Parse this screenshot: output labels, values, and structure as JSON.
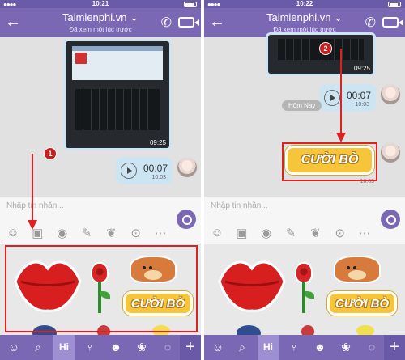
{
  "left": {
    "status_time": "10:21",
    "header_title": "Taimienphi.vn",
    "header_chevron": "⌄",
    "header_subtitle": "Đã xem một lúc trước",
    "photo_duration": "09:25",
    "voice_length": "00:07",
    "voice_time": "10:03",
    "input_placeholder": "Nhập tin nhắn...",
    "marker": "1"
  },
  "right": {
    "status_time": "10:22",
    "header_title": "Taimienphi.vn",
    "header_chevron": "⌄",
    "header_subtitle": "Đã xem một lúc trước",
    "photo_duration": "09:25",
    "voice_length": "00:07",
    "voice_time": "10:03",
    "day_label": "Hôm Nay",
    "sticker_text": "CƯỜI BÒ",
    "sticker_time": "10:03",
    "input_placeholder": "Nhập tin nhắn...",
    "marker": "2"
  },
  "sticker_panel": {
    "sticker_text": "CƯỜI BÒ"
  },
  "tabbar": {
    "hi_label": "Hi",
    "plus_label": "+"
  },
  "icons": [
    "back-arrow-icon",
    "phone-icon",
    "video-icon",
    "play-icon",
    "send-icon",
    "sticker-icon",
    "search-icon",
    "camera-icon",
    "doodle-icon",
    "gif-icon",
    "location-icon",
    "more-icon",
    "emoji-icon",
    "plus-icon"
  ],
  "colors": {
    "header": "#7b68b5",
    "bubble": "#cde5f3",
    "annotation": "#e02020",
    "sticker_yellow": "#f6c53a"
  }
}
